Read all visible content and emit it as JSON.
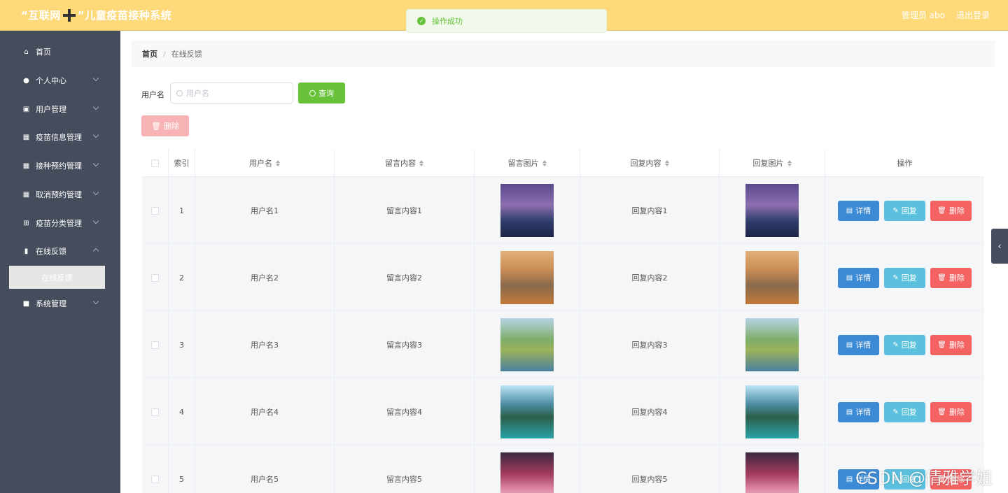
{
  "header": {
    "title_pre": "“互联网",
    "title_post": "”儿童疫苗接种系统",
    "user_label": "管理员 abo",
    "logout_label": "退出登录"
  },
  "toast": {
    "message": "操作成功"
  },
  "sidebar": {
    "items": [
      {
        "label": "首页",
        "icon": "home-icon",
        "arrow": false
      },
      {
        "label": "个人中心",
        "icon": "user-icon",
        "arrow": true
      },
      {
        "label": "用户管理",
        "icon": "clipboard-icon",
        "arrow": true
      },
      {
        "label": "疫苗信息管理",
        "icon": "grid-icon",
        "arrow": true
      },
      {
        "label": "接种预约管理",
        "icon": "grid-icon",
        "arrow": true
      },
      {
        "label": "取消预约管理",
        "icon": "grid-icon",
        "arrow": true
      },
      {
        "label": "疫苗分类管理",
        "icon": "apps-icon",
        "arrow": true
      },
      {
        "label": "在线反馈",
        "icon": "bar-chart-icon",
        "arrow": true
      },
      {
        "label": "系统管理",
        "icon": "briefcase-icon",
        "arrow": true
      }
    ],
    "active_sub": "在线反馈"
  },
  "breadcrumb": {
    "home": "首页",
    "separator": "/",
    "current": "在线反馈"
  },
  "search": {
    "label": "用户名",
    "placeholder": "用户名",
    "button": "查询"
  },
  "toolbar": {
    "delete_label": "删除"
  },
  "table": {
    "headers": [
      "索引",
      "用户名",
      "留言内容",
      "留言图片",
      "回复内容",
      "回复图片",
      "操作"
    ],
    "rows": [
      {
        "index": "1",
        "username": "用户名1",
        "message": "留言内容1",
        "reply": "回复内容1"
      },
      {
        "index": "2",
        "username": "用户名2",
        "message": "留言内容2",
        "reply": "回复内容2"
      },
      {
        "index": "3",
        "username": "用户名3",
        "message": "留言内容3",
        "reply": "回复内容3"
      },
      {
        "index": "4",
        "username": "用户名4",
        "message": "留言内容4",
        "reply": "回复内容4"
      },
      {
        "index": "5",
        "username": "用户名5",
        "message": "留言内容5",
        "reply": "回复内容5"
      }
    ],
    "actions": {
      "detail": "详情",
      "reply": "回复",
      "delete": "删除"
    }
  },
  "watermark": "CSDN @倩雅学姐",
  "colors": {
    "header": "#fdd97a",
    "sidebar": "#454c5b",
    "success": "#67c23a",
    "detail": "#3d8ad4",
    "reply": "#5bc0de",
    "danger": "#f56262"
  }
}
